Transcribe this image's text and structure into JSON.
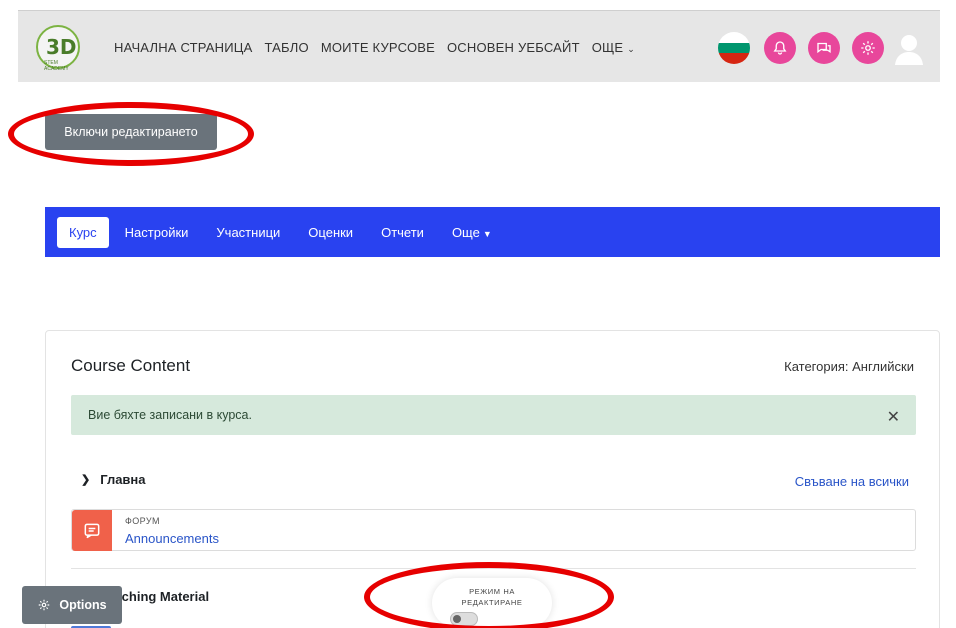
{
  "topbar": {
    "logo_text": "3D",
    "logo_sub": "STEM ACADEMY",
    "nav": [
      {
        "label": "НАЧАЛНА СТРАНИЦА"
      },
      {
        "label": "ТАБЛО"
      },
      {
        "label": "МОИТЕ КУРСОВЕ"
      },
      {
        "label": "ОСНОВЕН УЕБСАЙТ"
      },
      {
        "label": "ОЩЕ"
      }
    ],
    "flag_colors": [
      "#ffffff",
      "#00966e",
      "#d62612"
    ],
    "icon_color": "#e8479b"
  },
  "edit_button": {
    "label": "Включи редактирането"
  },
  "secondary_nav": {
    "accent": "#2942f0",
    "tabs": [
      {
        "label": "Курс"
      },
      {
        "label": "Настройки"
      },
      {
        "label": "Участници"
      },
      {
        "label": "Оценки"
      },
      {
        "label": "Отчети"
      },
      {
        "label": "Още"
      }
    ]
  },
  "course": {
    "title": "Course Content",
    "category": "Категория: Английски",
    "alert": "Вие бяхте записани в курса.",
    "collapse_all": "Свъване на всички",
    "sections": [
      {
        "name": "Главна",
        "activities": [
          {
            "type": "ФОРУМ",
            "name": "Announcements",
            "icon": "forum-icon"
          }
        ]
      },
      {
        "name": "Teaching Material"
      }
    ]
  },
  "options_button": {
    "label": "Options"
  },
  "edit_mode_toggle": {
    "label_line1": "РЕЖИМ НА",
    "label_line2": "РЕДАКТИРАНЕ",
    "enabled": false
  },
  "annotation_color": "#e60000"
}
